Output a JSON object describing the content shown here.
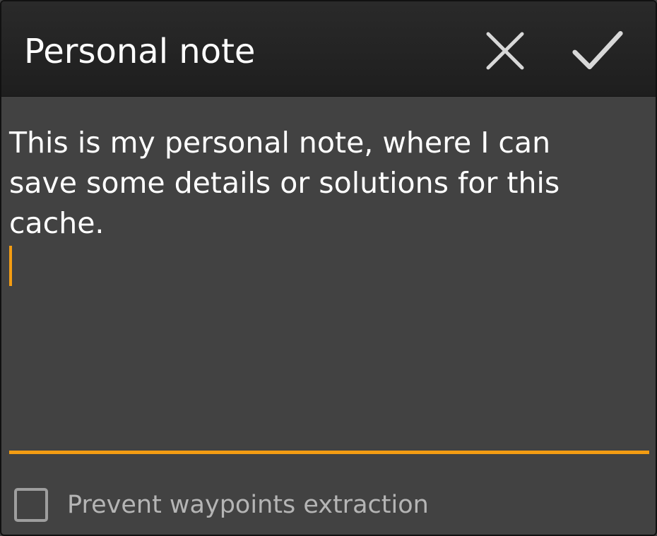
{
  "dialog": {
    "title": "Personal note",
    "actions": {
      "cancel_icon": "close-icon",
      "confirm_icon": "check-icon"
    }
  },
  "note": {
    "value": "This is my personal note, where I can\nsave some details or solutions for this\ncache."
  },
  "options": {
    "prevent_waypoints_label": "Prevent waypoints extraction",
    "prevent_waypoints_checked": false
  },
  "colors": {
    "accent": "#f39c12",
    "background": "#424242",
    "toolbar": "#1f1f1f",
    "text": "#ffffff",
    "secondary_text": "#b5b5b5"
  }
}
